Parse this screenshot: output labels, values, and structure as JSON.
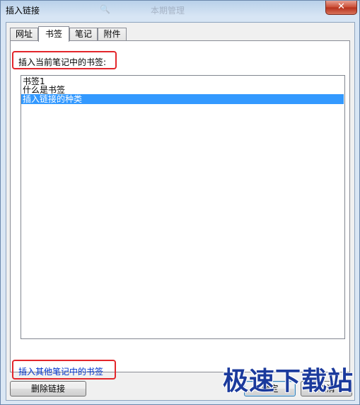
{
  "window": {
    "title": "插入链接",
    "close_glyph": "✕"
  },
  "background_toolbar": {
    "item": "本期管理"
  },
  "tabs": [
    {
      "label": "网址"
    },
    {
      "label": "书签"
    },
    {
      "label": "笔记"
    },
    {
      "label": "附件"
    }
  ],
  "active_tab": "书签",
  "bookmarks_panel": {
    "current_note_label": "插入当前笔记中的书签:",
    "list_items": [
      {
        "label": "书签1",
        "selected": false
      },
      {
        "label": "什么是书签",
        "selected": false
      },
      {
        "label": "插入链接的种类",
        "selected": true
      }
    ],
    "other_note_link": "插入其他笔记中的书签"
  },
  "buttons": {
    "delete_link": "删除链接",
    "ok": "确定",
    "cancel": "取消"
  },
  "watermark": "极速下载站",
  "colors": {
    "selection": "#3399ff",
    "highlight_border": "#e3262b",
    "link": "#0033cc"
  }
}
